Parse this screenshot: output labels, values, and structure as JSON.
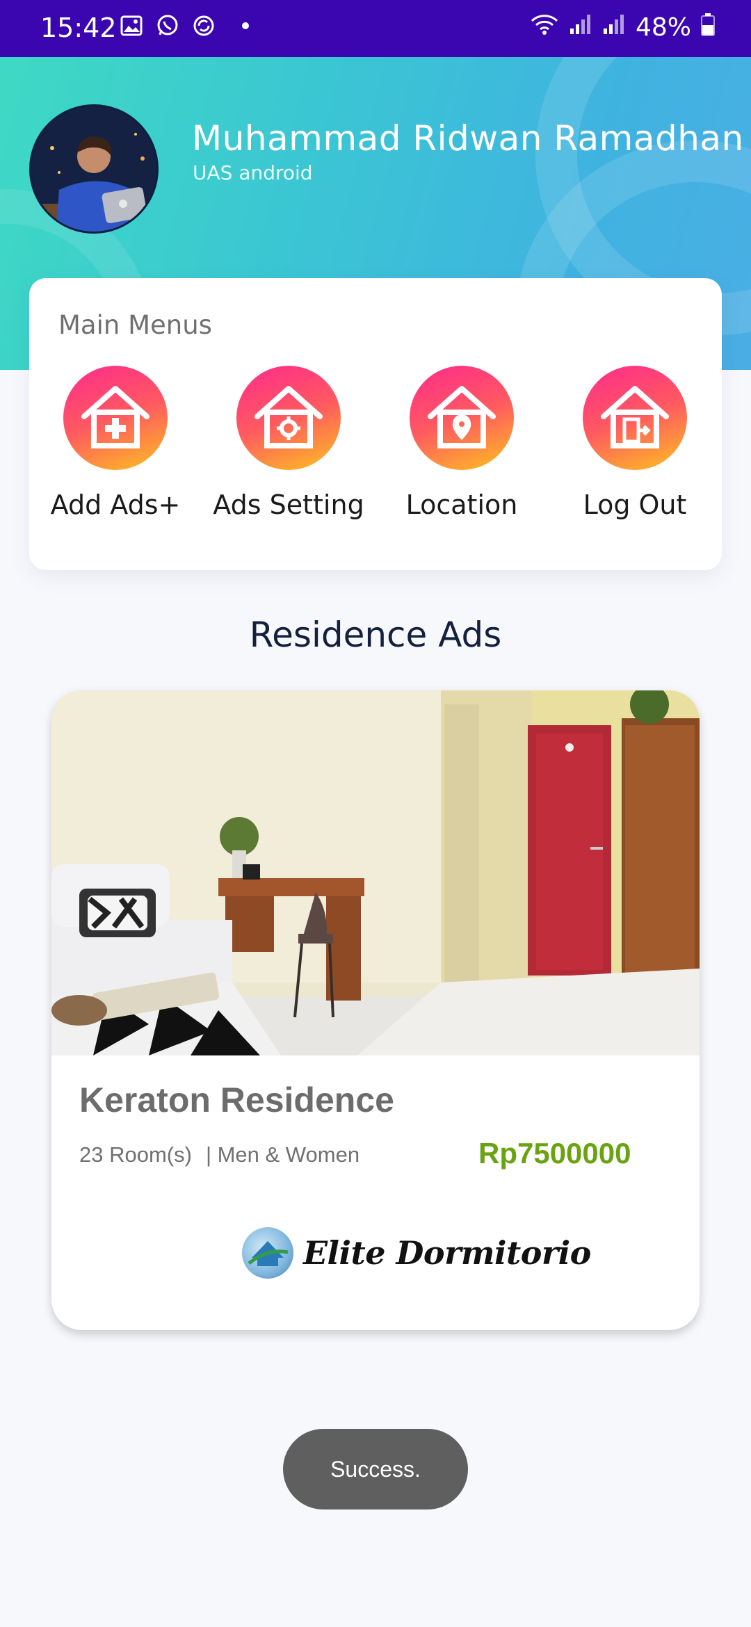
{
  "status_bar": {
    "time": "15:42",
    "battery": "48%",
    "icons_left": [
      "image-icon",
      "whatsapp-icon",
      "sync-icon"
    ],
    "icons_right": [
      "wifi-icon",
      "signal-icon",
      "signal-icon",
      "battery-icon"
    ]
  },
  "profile": {
    "name": "Muhammad Ridwan Ramadhan",
    "subtitle": "UAS android"
  },
  "menu": {
    "title": "Main Menus",
    "items": [
      {
        "label": "Add Ads+",
        "icon": "house-plus-icon"
      },
      {
        "label": "Ads Setting",
        "icon": "house-gear-icon"
      },
      {
        "label": "Location",
        "icon": "house-pin-icon"
      },
      {
        "label": "Log Out",
        "icon": "house-exit-icon"
      }
    ]
  },
  "ads": {
    "section_title": "Residence Ads",
    "listings": [
      {
        "title": "Keraton Residence",
        "rooms": "23 Room(s)",
        "gender": "| Men & Women",
        "price": "Rp7500000",
        "brand": "Elite Dormitorio"
      }
    ]
  },
  "toast": {
    "message": "Success."
  },
  "colors": {
    "status_bar": "#3b06b0",
    "header_start": "#3ed9c4",
    "header_end": "#4aaee4",
    "menu_gradient_top": "#ff2a8c",
    "menu_gradient_bottom": "#ffc21f",
    "price": "#6aa312"
  }
}
